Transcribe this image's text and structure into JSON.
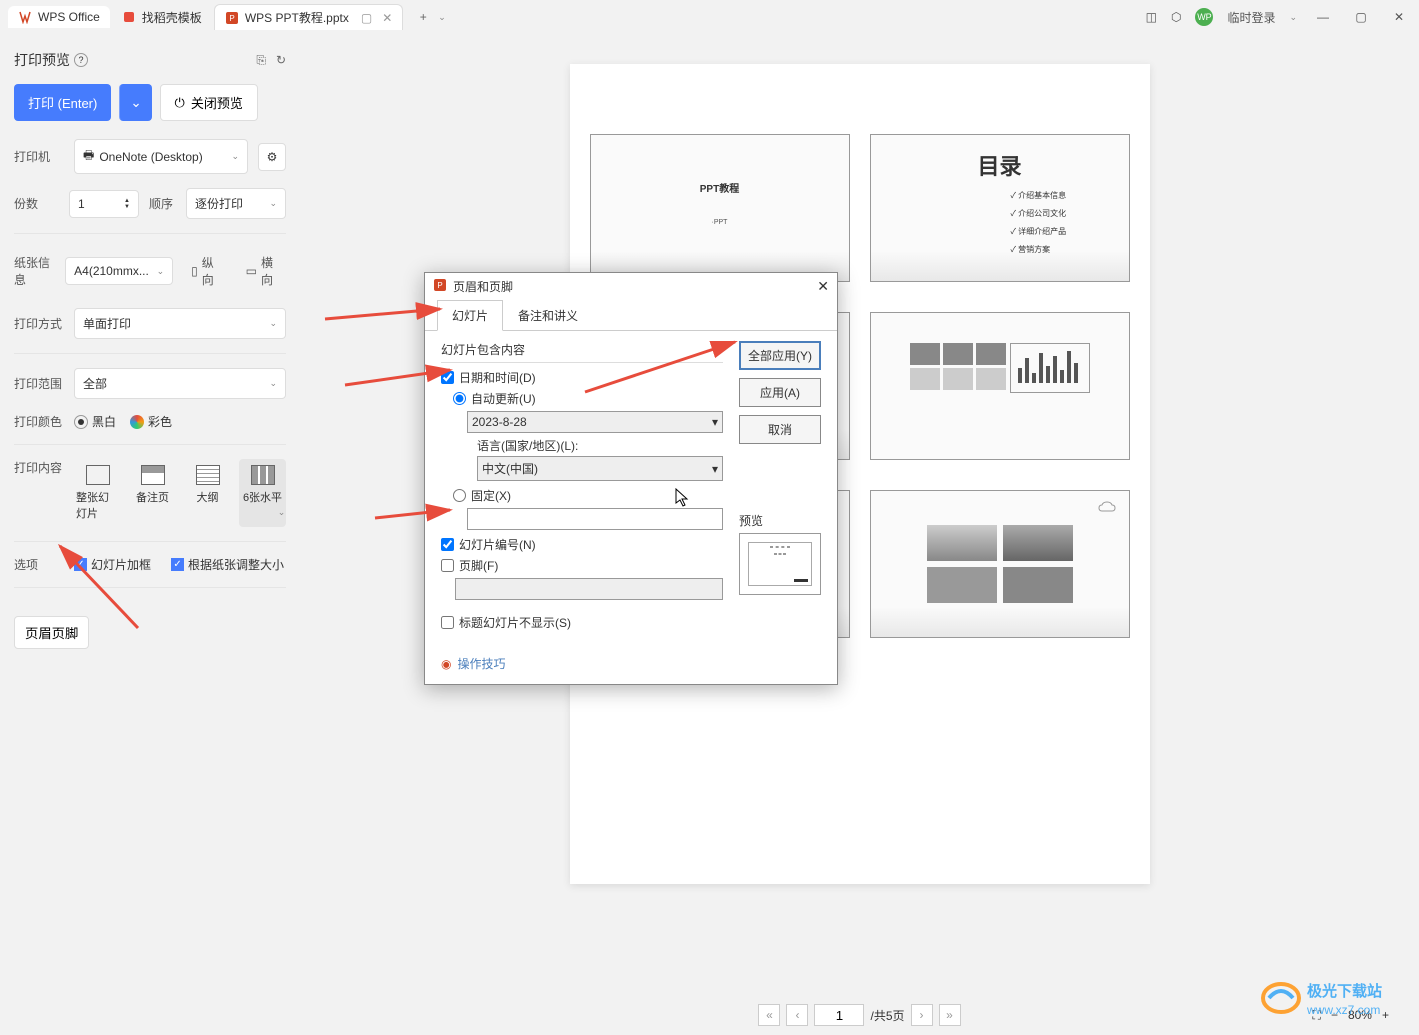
{
  "titlebar": {
    "home_tab": "WPS Office",
    "template_tab": "找稻壳模板",
    "file_tab": "WPS PPT教程.pptx",
    "login": "临时登录"
  },
  "panel": {
    "title": "打印预览",
    "print_btn": "打印 (Enter)",
    "close_btn": "关闭预览",
    "printer_label": "打印机",
    "printer_value": "OneNote (Desktop)",
    "copies_label": "份数",
    "copies_value": "1",
    "order_label": "顺序",
    "order_value": "逐份打印",
    "paper_label": "纸张信息",
    "paper_value": "A4(210mmx...",
    "portrait": "纵向",
    "landscape": "横向",
    "method_label": "打印方式",
    "method_value": "单面打印",
    "range_label": "打印范围",
    "range_value": "全部",
    "color_label": "打印颜色",
    "bw": "黑白",
    "color": "彩色",
    "content_label": "打印内容",
    "content_opts": [
      "整张幻灯片",
      "备注页",
      "大纲",
      "6张水平"
    ],
    "options_label": "选项",
    "frame_check": "幻灯片加框",
    "fit_check": "根据纸张调整大小",
    "hf_btn": "页眉页脚"
  },
  "dialog": {
    "title": "页眉和页脚",
    "tab1": "幻灯片",
    "tab2": "备注和讲义",
    "section": "幻灯片包含内容",
    "datetime": "日期和时间(D)",
    "autoupdate": "自动更新(U)",
    "date_value": "2023-8-28",
    "lang_label": "语言(国家/地区)(L):",
    "lang_value": "中文(中国)",
    "fixed": "固定(X)",
    "slide_num": "幻灯片编号(N)",
    "footer": "页脚(F)",
    "hide_title": "标题幻灯片不显示(S)",
    "apply_all": "全部应用(Y)",
    "apply": "应用(A)",
    "cancel": "取消",
    "preview": "预览",
    "tips": "操作技巧"
  },
  "slides": {
    "s1_title": "PPT教程",
    "s1_sub": "·PPT",
    "s2_title": "目录",
    "s2_items": [
      "✓ 介绍基本信息",
      "✓ 介绍公司文化",
      "✓ 详细介绍产品",
      "✓ 营销方案"
    ]
  },
  "statusbar": {
    "page": "1",
    "total": "/共5页",
    "zoom": "80%"
  },
  "watermark": {
    "line1": "极光下载站",
    "line2": "www.xz7.com"
  }
}
